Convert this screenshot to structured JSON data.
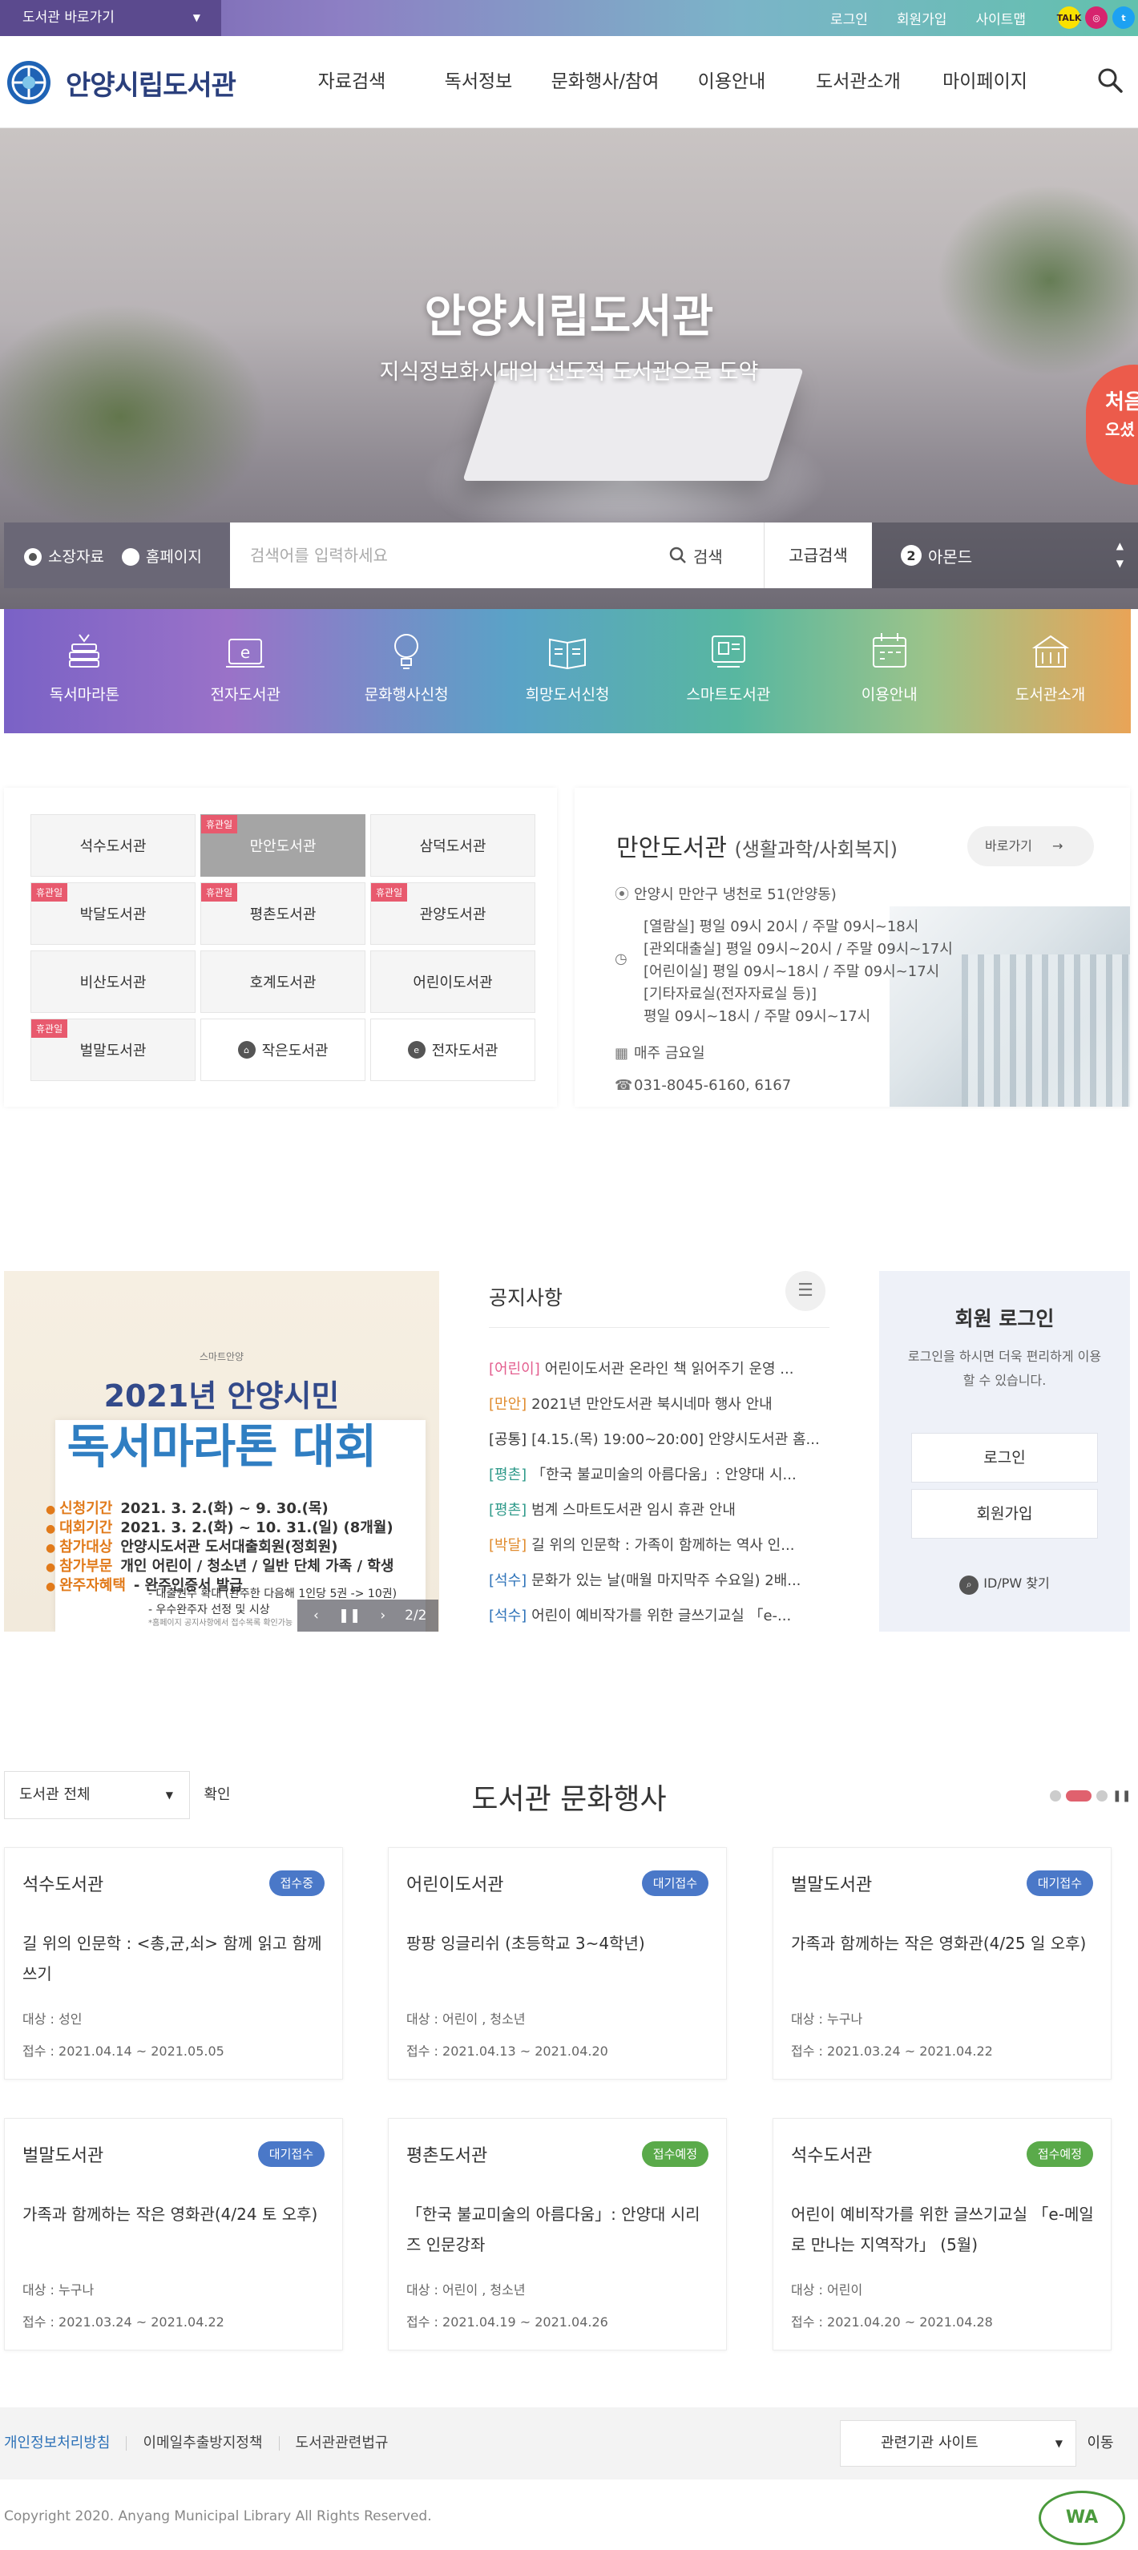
{
  "topbar": {
    "goto_label": "도서관 바로가기",
    "links": [
      "로그인",
      "회원가입",
      "사이트맵"
    ],
    "sns": [
      {
        "name": "kakao-talk-icon",
        "label": "TALK",
        "color": "#3c1e1e",
        "bg": "#fae100"
      },
      {
        "name": "instagram-icon",
        "label": "◎",
        "color": "#fff",
        "bg": "#d6246e"
      },
      {
        "name": "twitter-icon",
        "label": "t",
        "color": "#fff",
        "bg": "#1da1f2"
      }
    ]
  },
  "header": {
    "logo_text": "안양시립도서관",
    "nav": [
      "자료검색",
      "독서정보",
      "문화행사/참여",
      "이용안내",
      "도서관소개",
      "마이페이지"
    ]
  },
  "hero": {
    "title": "안양시립도서관",
    "subtitle": "지식정보화시대의 선도적 도서관으로 도약",
    "badge_line1": "처음",
    "badge_line2": "오셨"
  },
  "search": {
    "radio_collection": "소장자료",
    "radio_homepage": "홈페이지",
    "placeholder": "검색어를 입력하세요",
    "search_button": "검색",
    "advanced_button": "고급검색",
    "ticker_rank": "2",
    "ticker_text": "아몬드"
  },
  "quick_menu": [
    {
      "label": "독서마라톤",
      "icon": "book-stack-icon"
    },
    {
      "label": "전자도서관",
      "icon": "e-book-icon"
    },
    {
      "label": "문화행사신청",
      "icon": "lightbulb-icon"
    },
    {
      "label": "희망도서신청",
      "icon": "open-book-icon"
    },
    {
      "label": "스마트도서관",
      "icon": "smart-library-icon"
    },
    {
      "label": "이용안내",
      "icon": "calendar-icon"
    },
    {
      "label": "도서관소개",
      "icon": "library-building-icon"
    }
  ],
  "libraries": {
    "closed_tag": "휴관일",
    "items": [
      {
        "name": "석수도서관",
        "closed": false,
        "selected": false
      },
      {
        "name": "만안도서관",
        "closed": true,
        "selected": true
      },
      {
        "name": "삼덕도서관",
        "closed": false,
        "selected": false
      },
      {
        "name": "박달도서관",
        "closed": true,
        "selected": false
      },
      {
        "name": "평촌도서관",
        "closed": true,
        "selected": false
      },
      {
        "name": "관양도서관",
        "closed": true,
        "selected": false
      },
      {
        "name": "비산도서관",
        "closed": false,
        "selected": false
      },
      {
        "name": "호계도서관",
        "closed": false,
        "selected": false
      },
      {
        "name": "어린이도서관",
        "closed": false,
        "selected": false
      },
      {
        "name": "벌말도서관",
        "closed": true,
        "selected": false
      }
    ],
    "small_library": "작은도서관",
    "e_library": "전자도서관"
  },
  "library_info": {
    "name": "만안도서관",
    "category": "(생활과학/사회복지)",
    "go_label": "바로가기",
    "address": "안양시 만안구 냉천로 51(안양동)",
    "hours": [
      "[열람실] 평일 09시 20시 / 주말 09시~18시",
      "[관외대출실] 평일 09시~20시 / 주말 09시~17시",
      "[어린이실] 평일 09시~18시 / 주말 09시~17시",
      "[기타자료실(전자자료실 등)]",
      "평일 09시~18시 / 주말 09시~17시"
    ],
    "closed_day": "매주 금요일",
    "phone": "031-8045-6160, 6167"
  },
  "banner": {
    "small_text": "스마트안양",
    "title1": "2021년 안양시민",
    "title2": "독서마라톤 대회",
    "rows": [
      {
        "k": "신청기간",
        "v": "2021. 3. 2.(화) ~ 9. 30.(목)"
      },
      {
        "k": "대회기간",
        "v": "2021. 3. 2.(화) ~ 10. 31.(일) (8개월)"
      },
      {
        "k": "참가대상",
        "v": "안양시도서관 도서대출회원(정회원)"
      },
      {
        "k": "참가부문",
        "v": "개인 어린이 / 청소년 / 일반   단체 가족 / 학생"
      },
      {
        "k": "완주자혜택",
        "v": "- 완주인증서 발급"
      }
    ],
    "benefit2": "- 대출권수 확대 (완주한 다음해 1인당 5권 -> 10권)",
    "benefit3": "- 우수완주자 선정 및 시상",
    "footnote": "*홈페이지 공지사항에서 접수목록 확인가능",
    "brand": "안양시도서관",
    "page": "2/2"
  },
  "notice": {
    "title": "공지사항",
    "more": "☰",
    "items": [
      {
        "tag": "[어린이]",
        "text": "어린이도서관 온라인 책 읽어주기 운영 ...",
        "color": "#e35d8e"
      },
      {
        "tag": "[만안]",
        "text": "2021년 만안도서관 북시네마 행사 안내",
        "color": "#e08b2e"
      },
      {
        "tag": "[공통]",
        "text": "[4.15.(목) 19:00~20:00] 안양시도서관 홈...",
        "color": "#333"
      },
      {
        "tag": "[평촌]",
        "text": "「한국 불교미술의 아름다움」: 안양대 시...",
        "color": "#2f9a8a"
      },
      {
        "tag": "[평촌]",
        "text": "범계 스마트도서관 임시 휴관 안내",
        "color": "#2f9a8a"
      },
      {
        "tag": "[박달]",
        "text": "길 위의 인문학 : 가족이 함께하는 역사 인...",
        "color": "#e08b2e"
      },
      {
        "tag": "[석수]",
        "text": "문화가 있는 날(매월 마지막주 수요일) 2배...",
        "color": "#2d72b8"
      },
      {
        "tag": "[석수]",
        "text": "어린이 예비작가를 위한 글쓰기교실 「e-...",
        "color": "#2d72b8"
      }
    ]
  },
  "login": {
    "title": "회원 로그인",
    "desc": "로그인을 하시면 더욱 편리하게 이용할 수 있습니다.",
    "login_button": "로그인",
    "join_button": "회원가입",
    "find": "ID/PW 찾기"
  },
  "events": {
    "select_value": "도서관 전체",
    "ok_button": "확인",
    "title": "도서관 문화행사",
    "target_prefix": "대상 : ",
    "date_prefix": "접수 : ",
    "cards": [
      {
        "lib": "석수도서관",
        "status": "접수중",
        "color": "#4a78c8",
        "title": "길 위의 인문학 : <총,균,쇠> 함께 읽고 함께 쓰기",
        "target": "성인",
        "date": "2021.04.14 ~ 2021.05.05"
      },
      {
        "lib": "어린이도서관",
        "status": "대기접수",
        "color": "#4a78c8",
        "title": "팡팡 잉글리쉬 (초등학교 3~4학년)",
        "target": "어린이 , 청소년",
        "date": "2021.04.13 ~ 2021.04.20"
      },
      {
        "lib": "벌말도서관",
        "status": "대기접수",
        "color": "#4a78c8",
        "title": "가족과 함께하는 작은 영화관(4/25 일 오후)",
        "target": "누구나",
        "date": "2021.03.24 ~ 2021.04.22"
      },
      {
        "lib": "벌말도서관",
        "status": "대기접수",
        "color": "#4a78c8",
        "title": "가족과 함께하는 작은 영화관(4/24 토 오후)",
        "target": "누구나",
        "date": "2021.03.24 ~ 2021.04.22"
      },
      {
        "lib": "평촌도서관",
        "status": "접수예정",
        "color": "#5aaa4a",
        "title": "「한국 불교미술의 아름다움」: 안양대 시리즈 인문강좌",
        "target": "어린이 , 청소년",
        "date": "2021.04.19 ~ 2021.04.26"
      },
      {
        "lib": "석수도서관",
        "status": "접수예정",
        "color": "#5aaa4a",
        "title": "어린이 예비작가를 위한 글쓰기교실 「e-메일로 만나는 지역작가」 (5월)",
        "target": "어린이",
        "date": "2021.04.20 ~ 2021.04.28"
      }
    ]
  },
  "footer": {
    "links": [
      "개인정보처리방침",
      "이메일추출방지정책",
      "도서관관련법규"
    ],
    "related_select": "관련기관 사이트",
    "go_button": "이동",
    "copyright": "Copyright 2020. Anyang Municipal Library All Rights Reserved.",
    "wa_label": "WA"
  }
}
